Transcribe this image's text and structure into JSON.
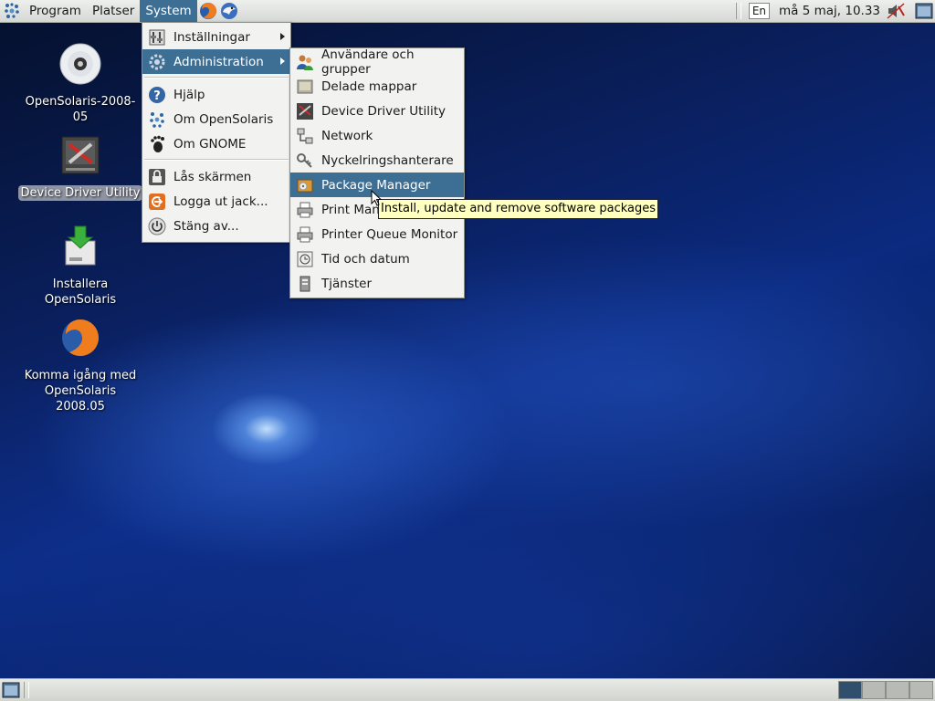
{
  "top_panel": {
    "menus": [
      "Program",
      "Platser",
      "System"
    ],
    "keyboard_layout": "En",
    "clock": "må  5 maj, 10.33"
  },
  "desktop_icons": [
    {
      "label": "OpenSolaris-2008-05",
      "icon": "cd-icon"
    },
    {
      "label": "Device Driver Utility",
      "icon": "device-driver-icon",
      "selected": true
    },
    {
      "label": "Installera OpenSolaris",
      "icon": "install-icon"
    },
    {
      "label": "Komma igång med OpenSolaris 2008.05",
      "icon": "firefox-icon"
    }
  ],
  "system_menu": {
    "items": [
      {
        "label": "Inställningar",
        "icon": "preferences-icon",
        "submenu": true
      },
      {
        "label": "Administration",
        "icon": "administration-icon",
        "submenu": true,
        "highlighted": true
      },
      {
        "label": "Hjälp",
        "icon": "help-icon"
      },
      {
        "label": "Om OpenSolaris",
        "icon": "opensolaris-icon"
      },
      {
        "label": "Om GNOME",
        "icon": "gnome-foot-icon"
      },
      {
        "label": "Lås skärmen",
        "icon": "lock-icon"
      },
      {
        "label": "Logga ut jack...",
        "icon": "logout-icon"
      },
      {
        "label": "Stäng av...",
        "icon": "shutdown-icon"
      }
    ]
  },
  "admin_menu": {
    "items": [
      {
        "label": "Användare och grupper",
        "icon": "users-icon"
      },
      {
        "label": "Delade mappar",
        "icon": "shared-folder-icon"
      },
      {
        "label": "Device Driver Utility",
        "icon": "device-driver-icon"
      },
      {
        "label": "Network",
        "icon": "network-icon"
      },
      {
        "label": "Nyckelringshanterare",
        "icon": "keyring-icon"
      },
      {
        "label": "Package Manager",
        "icon": "package-icon",
        "highlighted": true
      },
      {
        "label": "Print Manager",
        "icon": "printer-icon"
      },
      {
        "label": "Printer Queue Monitor",
        "icon": "printer-queue-icon"
      },
      {
        "label": "Tid och datum",
        "icon": "clock-icon"
      },
      {
        "label": "Tjänster",
        "icon": "services-icon"
      }
    ]
  },
  "tooltip": "Install, update and remove software packages",
  "colors": {
    "highlight": "#3d6f95",
    "tooltip_bg": "#ffffbf"
  }
}
